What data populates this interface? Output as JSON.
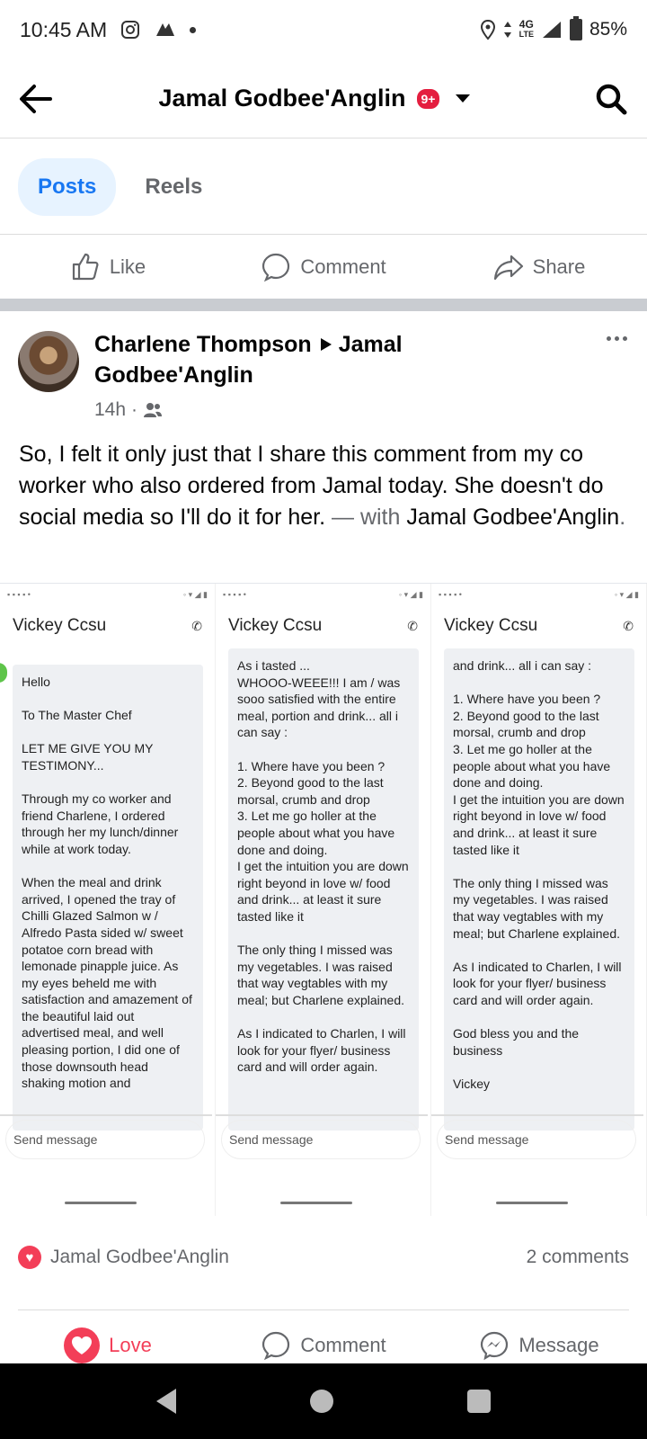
{
  "status_bar": {
    "time": "10:45 AM",
    "network": "4G",
    "network_sub": "LTE",
    "battery": "85%"
  },
  "header": {
    "title": "Jamal Godbee'Anglin",
    "badge": "9+"
  },
  "tabs": [
    {
      "label": "Posts"
    },
    {
      "label": "Reels"
    }
  ],
  "top_actions": {
    "like": "Like",
    "comment": "Comment",
    "share": "Share"
  },
  "post": {
    "author": "Charlene Thompson",
    "target": "Jamal Godbee'Anglin",
    "time": "14h",
    "text": "So, I felt it only just that I share this comment from my co worker who also ordered from Jamal today.  She doesn't do social media so I'll do it for her.",
    "with_sep": " — with ",
    "with_name": "Jamal Godbee'Anglin",
    "with_end": "."
  },
  "collage": {
    "contact": "Vickey Ccsu",
    "send_placeholder": "Send message",
    "shot1": "Hello\n\nTo The Master Chef\n\nLET ME GIVE YOU MY TESTIMONY...\n\nThrough my co  worker and friend Charlene, I ordered through her my lunch/dinner while at work today.\n\nWhen the meal and drink arrived, I opened the tray of Chilli Glazed Salmon w / Alfredo Pasta sided w/ sweet potatoe corn bread with lemonade pinapple juice.  As my eyes beheld me with satisfaction and amazement of the beautiful laid out advertised meal, and well pleasing portion, I did one of those downsouth head shaking motion and",
    "shot2": "As i tasted ...\nWHOOO-WEEE!!! I am / was sooo satisfied with the entire meal,  portion and drink... all i can say :\n\n1.  Where have you been ?\n2.  Beyond good to the last morsal, crumb and drop\n3. Let me go holler    at the people about what you have done and doing.\nI get the intuition you are down right  beyond in love w/ food and drink... at least it sure tasted like it\n\nThe only thing I missed was my vegetables.  I was raised that way vegtables with my meal; but Charlene explained.\n\nAs I indicated to Charlen, I will look for your flyer/ business card and will order again.",
    "shot3": "and drink... all i can say :\n\n1.  Where have you been ?\n2.  Beyond good to the last morsal, crumb and drop\n3. Let me go holler    at the people about what you have done and doing.\nI get the intuition you are down right  beyond in love w/ food and drink... at least it sure tasted like it\n\nThe only thing I missed was my vegetables.  I was raised that way vegtables with my meal; but Charlene explained.\n\nAs I indicated to Charlen, I will look for your flyer/ business card and will order again.\n\nGod bless you and  the business\n\nVickey"
  },
  "summary": {
    "reactor": "Jamal Godbee'Anglin",
    "comments": "2 comments"
  },
  "bottom_actions": {
    "love": "Love",
    "comment": "Comment",
    "message": "Message"
  },
  "colors": {
    "accent": "#1877f2",
    "love": "#f33e58",
    "secondary_text": "#65676b"
  }
}
